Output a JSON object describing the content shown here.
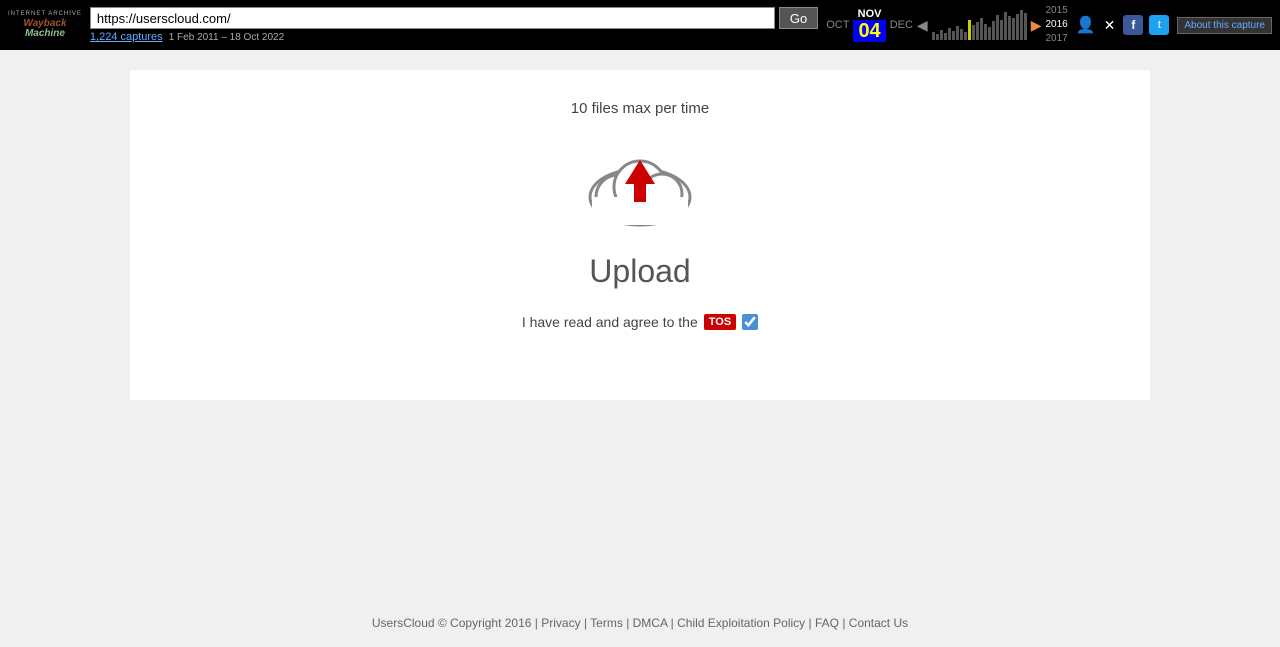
{
  "wayback": {
    "logo_top": "INTERNET ARCHIVE",
    "brand_wayback": "Wayback",
    "brand_machine": "Machine",
    "url": "https://userscloud.com/",
    "go_label": "Go",
    "captures_link": "1,224 captures",
    "captures_date": "1 Feb 2011 – 18 Oct 2022",
    "months": {
      "prev": "OCT",
      "current": "NOV",
      "next": "DEC"
    },
    "day": "04",
    "years": {
      "prev": "2015",
      "current": "2016",
      "next": "2017"
    },
    "about_label": "About this capture",
    "user_icon": "👤",
    "close_icon": "✕"
  },
  "main": {
    "files_max": "10 files max per time",
    "upload_label": "Upload",
    "tos_text": "I have read and agree to the",
    "tos_badge": "TOS"
  },
  "footer": {
    "copyright": "UsersCloud © Copyright 2016",
    "links": [
      "Privacy",
      "Terms",
      "DMCA",
      "Child Exploitation Policy",
      "FAQ",
      "Contact Us"
    ]
  }
}
